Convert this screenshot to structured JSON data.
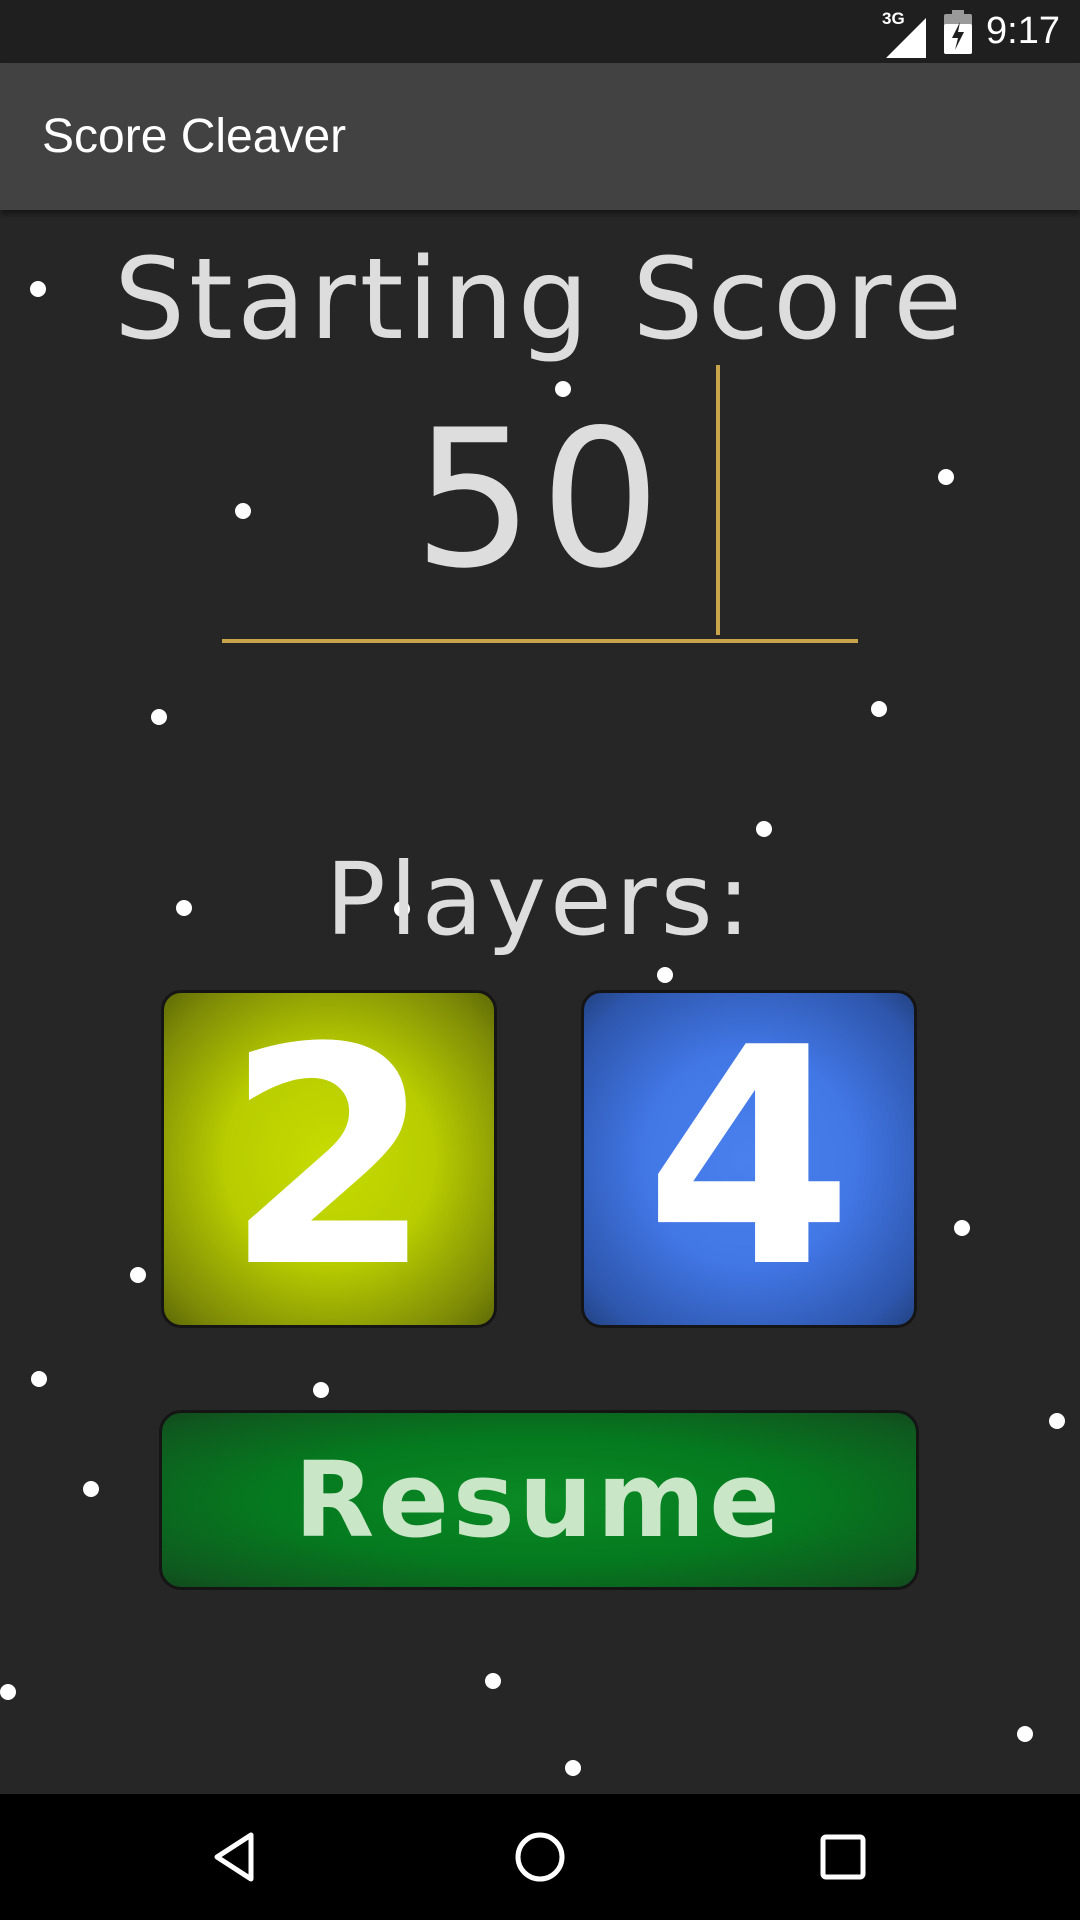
{
  "status_bar": {
    "network_type": "3G",
    "time": "9:17",
    "icons": [
      "signal-icon",
      "battery-charging-icon"
    ]
  },
  "app_bar": {
    "title": "Score Cleaver"
  },
  "main": {
    "starting_score_label": "Starting Score",
    "starting_score_value": "50",
    "players_label": "Players:",
    "player_options": [
      {
        "label": "2",
        "color": "#b8cc00"
      },
      {
        "label": "4",
        "color": "#4277e6"
      }
    ],
    "resume_label": "Resume"
  },
  "nav_bar": {
    "icons": [
      "back-icon",
      "home-icon",
      "recents-icon"
    ]
  },
  "colors": {
    "background": "#262626",
    "app_bar": "#424242",
    "accent": "#c8a44a",
    "resume": "#057a1f",
    "text": "#dddddd"
  }
}
